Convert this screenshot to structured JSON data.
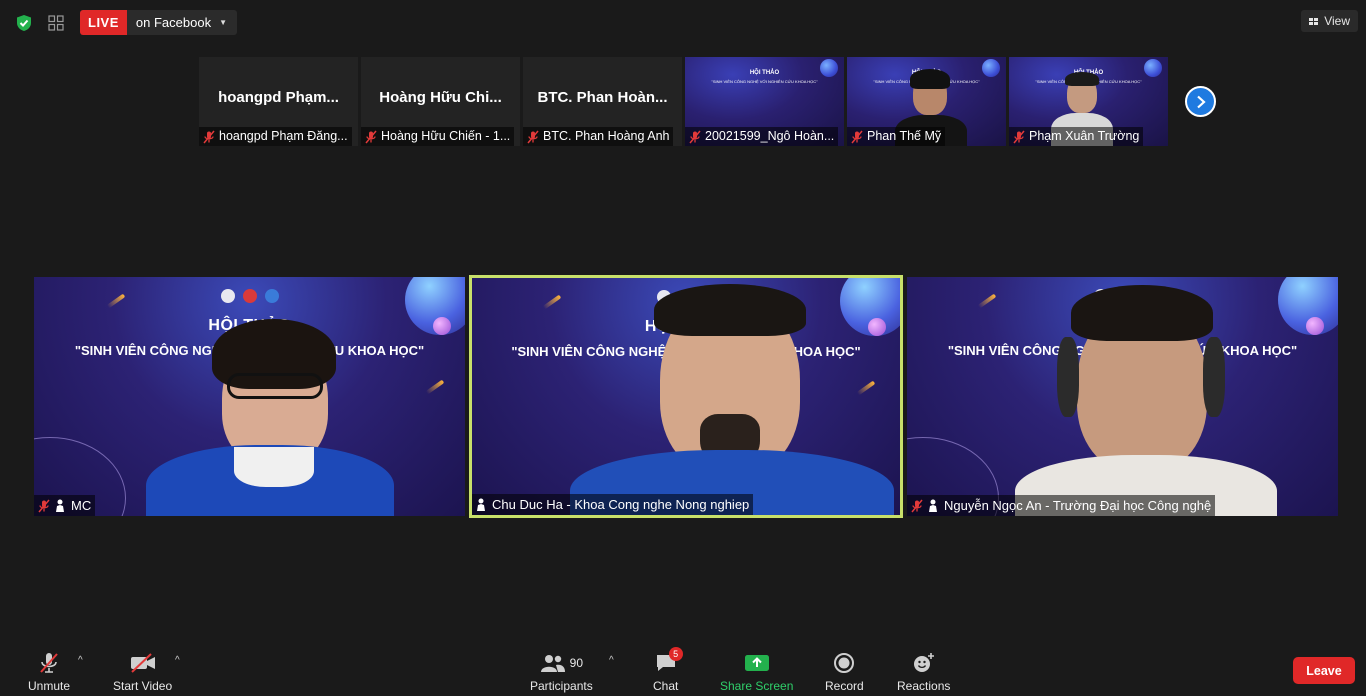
{
  "top_bar": {
    "live_label": "LIVE",
    "live_target": "on Facebook",
    "view_label": "View"
  },
  "thumbnails": [
    {
      "display_name": "hoangpd  Phạm...",
      "label": "hoangpd Phạm Đăng...",
      "muted": true,
      "video": false
    },
    {
      "display_name": "Hoàng  Hữu  Chi...",
      "label": "Hoàng Hữu Chiến - 1...",
      "muted": true,
      "video": false
    },
    {
      "display_name": "BTC.  Phan  Hoàn...",
      "label": "BTC. Phan Hoàng Anh",
      "muted": true,
      "video": false
    },
    {
      "label": "20021599_Ngô Hoàn...",
      "muted": true,
      "video": true
    },
    {
      "label": "Phan Thế Mỹ",
      "muted": true,
      "video": true
    },
    {
      "label": "Phạm Xuân Trường",
      "muted": true,
      "video": true
    }
  ],
  "banner": {
    "title": "HỘI THẢO",
    "subtitle": "\"SINH VIÊN CÔNG NGHỆ VỚI NGHIÊN CỨU KHOA HỌC\""
  },
  "main_tiles": [
    {
      "label": "MC",
      "muted": true,
      "pinned": true,
      "active": false
    },
    {
      "label": "Chu Duc Ha - Khoa Cong nghe Nong nghiep",
      "muted": false,
      "pinned": true,
      "active": true
    },
    {
      "label": "Nguyễn Ngọc An - Trường Đại học Công nghệ",
      "muted": true,
      "pinned": true,
      "active": false
    }
  ],
  "toolbar": {
    "unmute_label": "Unmute",
    "start_video_label": "Start Video",
    "participants_label": "Participants",
    "participants_count": "90",
    "chat_label": "Chat",
    "chat_badge": "5",
    "share_label": "Share Screen",
    "record_label": "Record",
    "reactions_label": "Reactions",
    "leave_label": "Leave"
  },
  "colors": {
    "live_red": "#e02828",
    "active_speaker_border": "#c8e06a",
    "share_green": "#2fcf6a",
    "next_blue": "#1f7ae0"
  }
}
